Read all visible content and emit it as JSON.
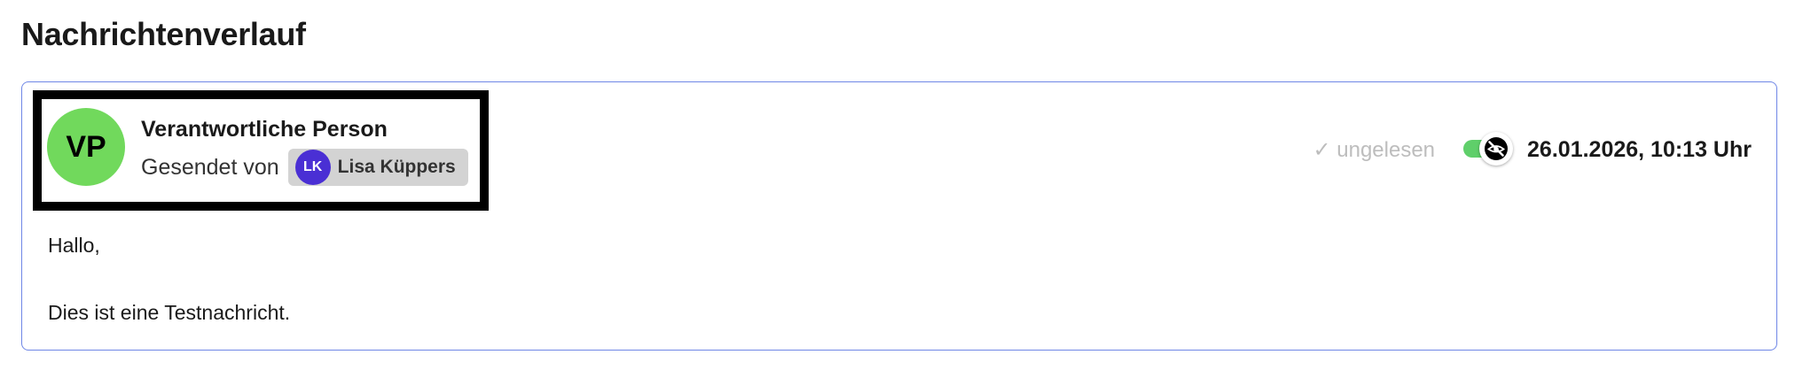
{
  "section": {
    "title": "Nachrichtenverlauf"
  },
  "message": {
    "sender": {
      "avatar_initials": "VP",
      "avatar_color": "#71d95c",
      "role": "Verantwortliche Person",
      "sent_by_label": "Gesendet von",
      "user": {
        "initials": "LK",
        "avatar_color": "#4a2fd4",
        "name": "Lisa Küppers"
      }
    },
    "status": {
      "unread_label": "✓ ungelesen",
      "toggle_on": true,
      "toggle_icon": "no-eye-icon"
    },
    "timestamp": "26.01.2026, 10:13 Uhr",
    "body": {
      "greeting": "Hallo,",
      "text": "Dies ist eine Testnachricht."
    }
  },
  "colors": {
    "card_border": "#6f87e6",
    "toggle_track": "#5fcf6a",
    "chip_background": "#d3d3d3"
  }
}
